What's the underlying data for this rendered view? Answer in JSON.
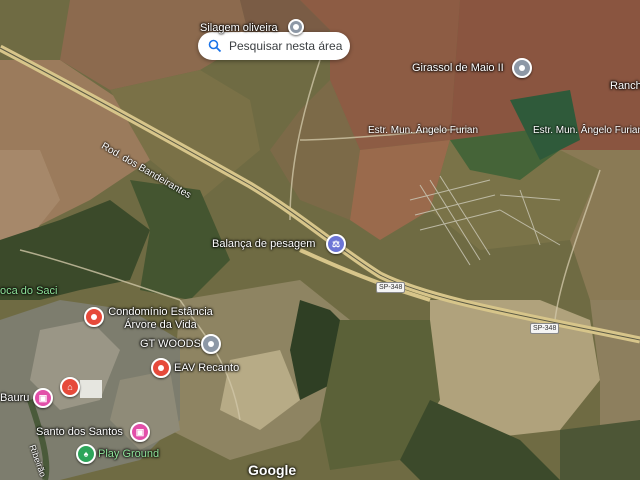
{
  "search": {
    "label": "Pesquisar nesta área",
    "icon": "search-icon"
  },
  "places": [
    {
      "name": "Silagem oliveira",
      "icon": "grey-place-pin"
    },
    {
      "name": "Girassol de Maio II",
      "icon": "grey-place-pin"
    },
    {
      "name": "Ranch",
      "icon": "none"
    },
    {
      "name": "Balança de pesagem",
      "icon": "weigh-station-pin"
    },
    {
      "name": "Condomínio Estância Árvore da Vida",
      "icon": "red-place-pin"
    },
    {
      "name": "GT WOODS",
      "icon": "grey-place-pin"
    },
    {
      "name": "EAV Recanto",
      "icon": "red-place-pin"
    },
    {
      "name": "Bauru",
      "icon": "pink-place-pin"
    },
    {
      "name": "Santo dos Santos",
      "icon": "pink-place-pin"
    },
    {
      "name": "Play Ground",
      "icon": "green-park-pin"
    },
    {
      "name": "oca do Saci",
      "icon": "none"
    }
  ],
  "roads": {
    "bandeirantes": "Rod. dos Bandeirantes",
    "furian_1": "Estr. Mun. Ângelo Furian",
    "furian_2": "Estr. Mun. Ângelo Furian",
    "sp348_a": "SP-348",
    "sp348_b": "SP-348",
    "ribeirao": "Ribeirão"
  },
  "branding": {
    "logo": "Google"
  },
  "colors": {
    "pin_red": "#e64a3b",
    "pin_grey": "#8d98a6",
    "pin_pink": "#e24fa9",
    "pin_green": "#2da55a",
    "park_text": "#8fe39a"
  }
}
